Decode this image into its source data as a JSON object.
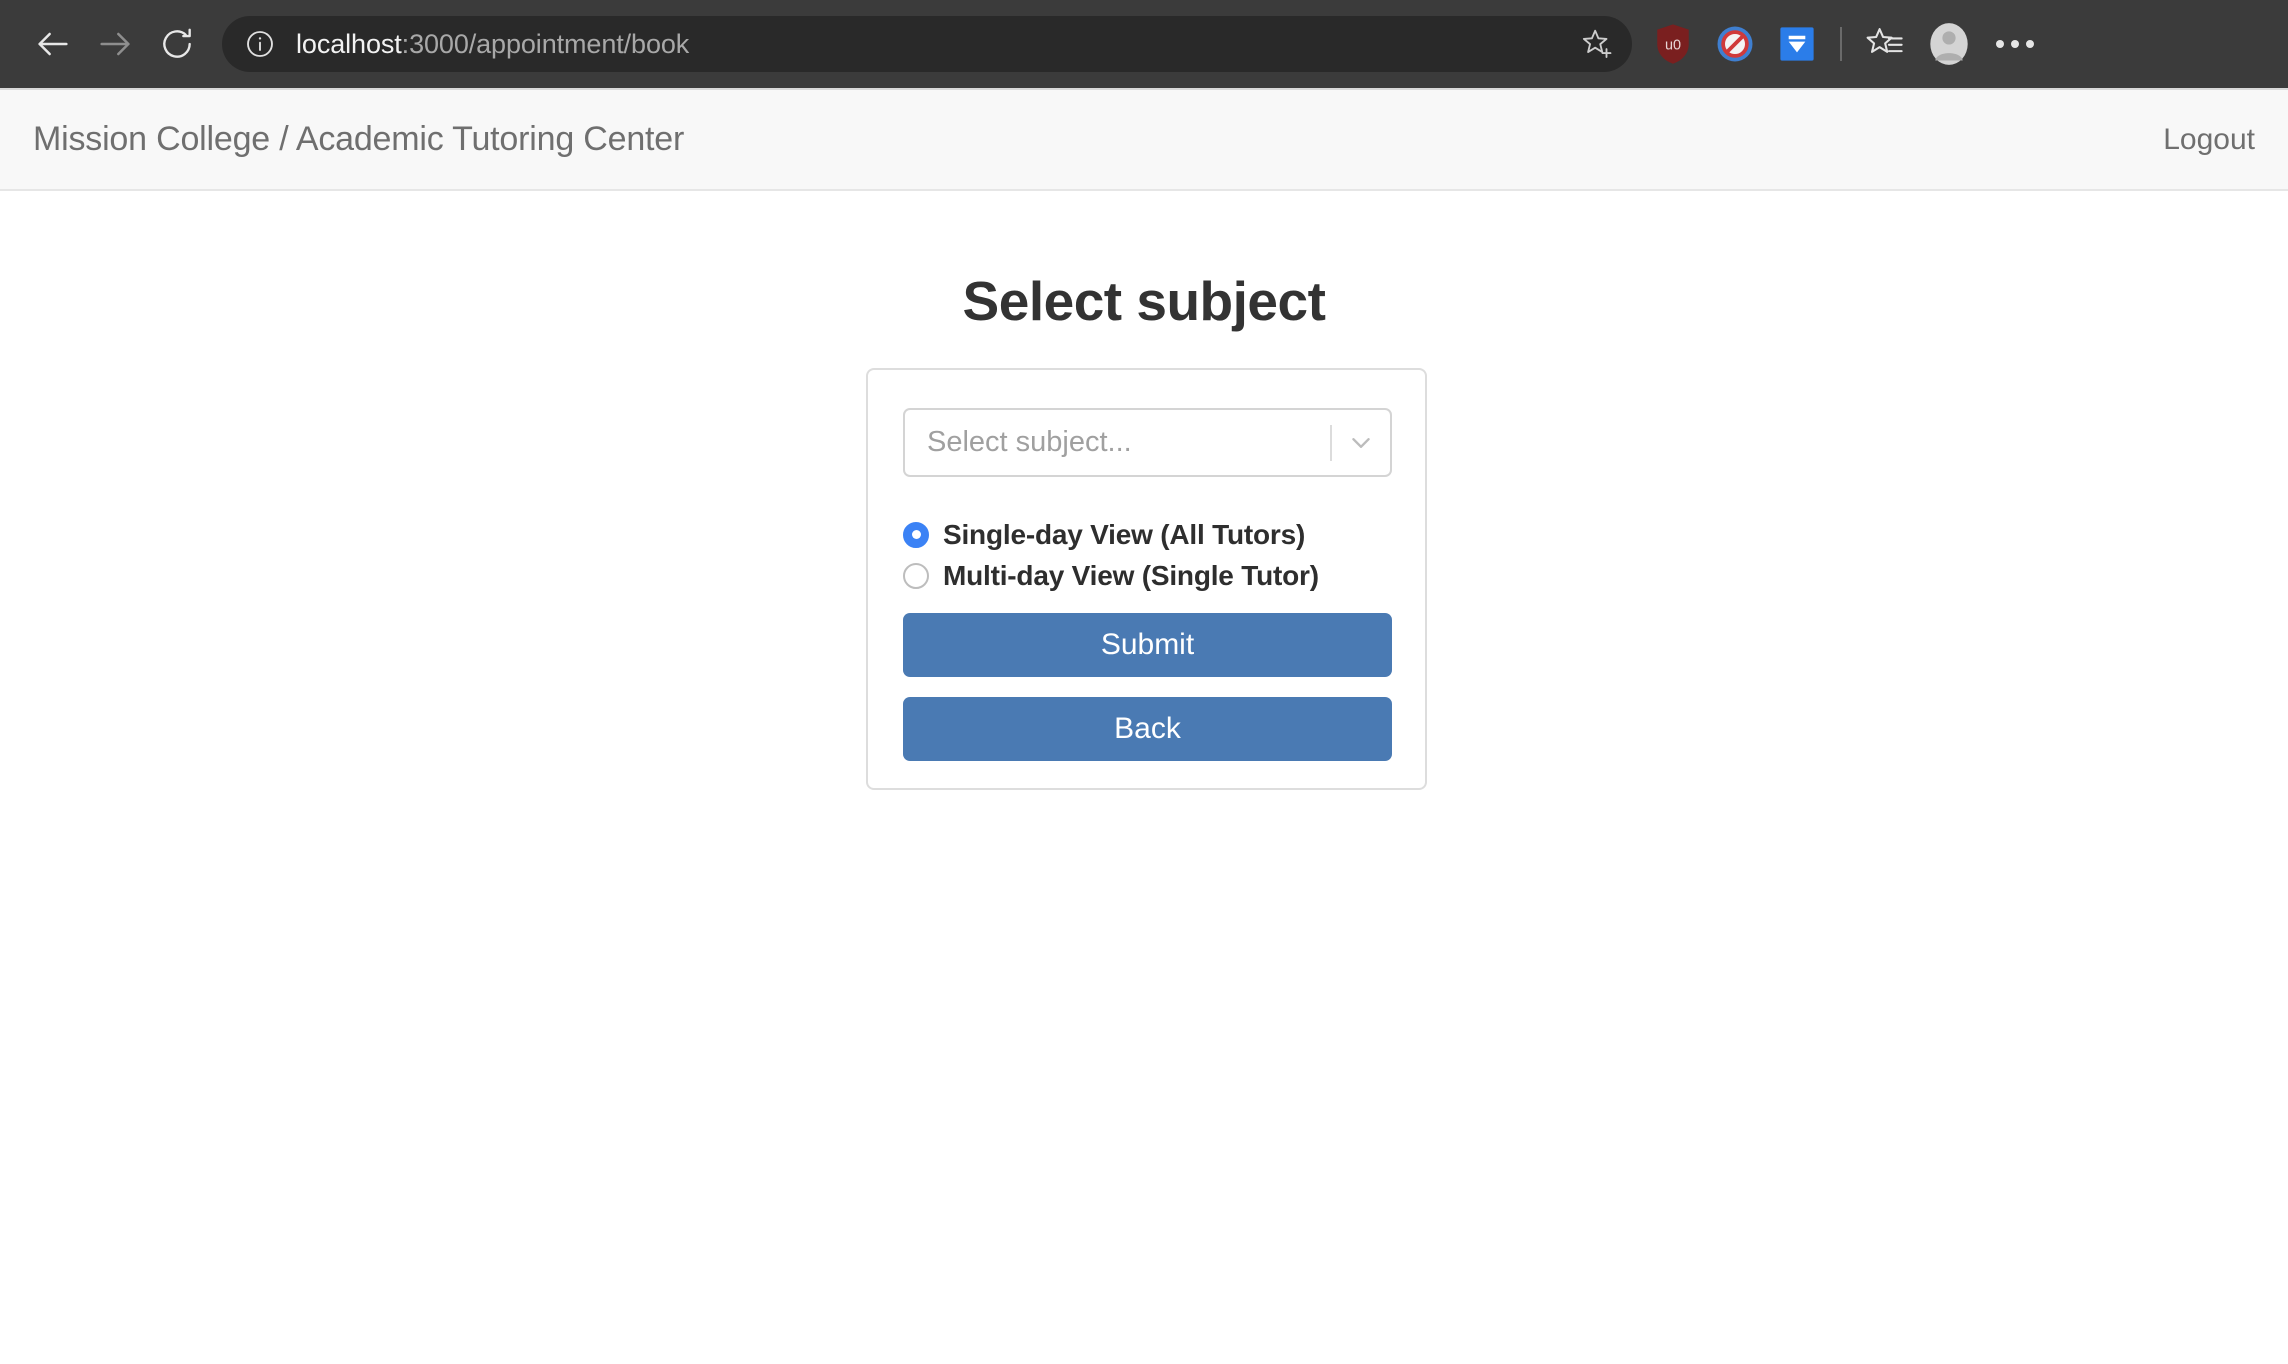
{
  "browser": {
    "back_label": "Back",
    "forward_label": "Forward",
    "reload_label": "Refresh",
    "url_host": "localhost",
    "url_path": ":3000/appointment/book",
    "url_full": "localhost:3000/appointment/book",
    "info_icon": "site-information-icon",
    "add_favorite_icon": "star-plus-icon",
    "extensions": [
      {
        "name": "ublock-origin-icon",
        "label": "uBlock Origin",
        "color": "#7a1f1f"
      },
      {
        "name": "adblock-icon",
        "label": "AdBlock",
        "color": "#3f7fd0"
      },
      {
        "name": "extension-blue-icon",
        "label": "Extension",
        "color": "#2b7de9"
      }
    ],
    "collections_icon": "favorites-list-icon",
    "profile_icon": "profile-avatar-icon",
    "menu_icon": "more-options-icon"
  },
  "navbar": {
    "brand": "Mission College / Academic Tutoring Center",
    "logout_label": "Logout"
  },
  "main": {
    "page_title": "Select subject",
    "subject_select": {
      "placeholder": "Select subject...",
      "value": "",
      "dropdown_icon": "chevron-down-icon"
    },
    "view_options": [
      {
        "label": "Single-day View (All Tutors)",
        "selected": true
      },
      {
        "label": "Multi-day View (Single Tutor)",
        "selected": false
      }
    ],
    "submit_label": "Submit",
    "back_label": "Back"
  },
  "colors": {
    "chrome_bg": "#3b3b3b",
    "omnibox_bg": "#292929",
    "navbar_bg": "#f8f8f8",
    "button_blue": "#4a7ab3",
    "radio_blue": "#3b82f5",
    "text_gray": "#6f6f6f",
    "heading": "#333333"
  }
}
